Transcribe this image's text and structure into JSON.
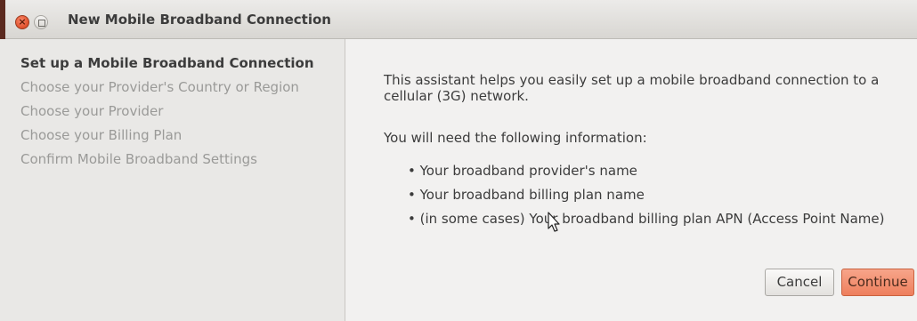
{
  "window": {
    "title": "New Mobile Broadband Connection"
  },
  "sidebar": {
    "items": [
      {
        "label": "Set up a Mobile Broadband Connection",
        "state": "current"
      },
      {
        "label": "Choose your Provider's Country or Region",
        "state": "pending"
      },
      {
        "label": "Choose your Provider",
        "state": "pending"
      },
      {
        "label": "Choose your Billing Plan",
        "state": "pending"
      },
      {
        "label": "Confirm Mobile Broadband Settings",
        "state": "pending"
      }
    ]
  },
  "content": {
    "intro": "This assistant helps you easily set up a mobile broadband connection to a cellular (3G) network.",
    "need": "You will need the following information:",
    "requirements": [
      "• Your broadband provider's name",
      "• Your broadband billing plan name",
      "• (in some cases) Your broadband billing plan APN (Access Point Name)"
    ]
  },
  "buttons": {
    "cancel": "Cancel",
    "continue": "Continue"
  },
  "colors": {
    "accent": "#ee7f5d",
    "close": "#e0502b"
  }
}
